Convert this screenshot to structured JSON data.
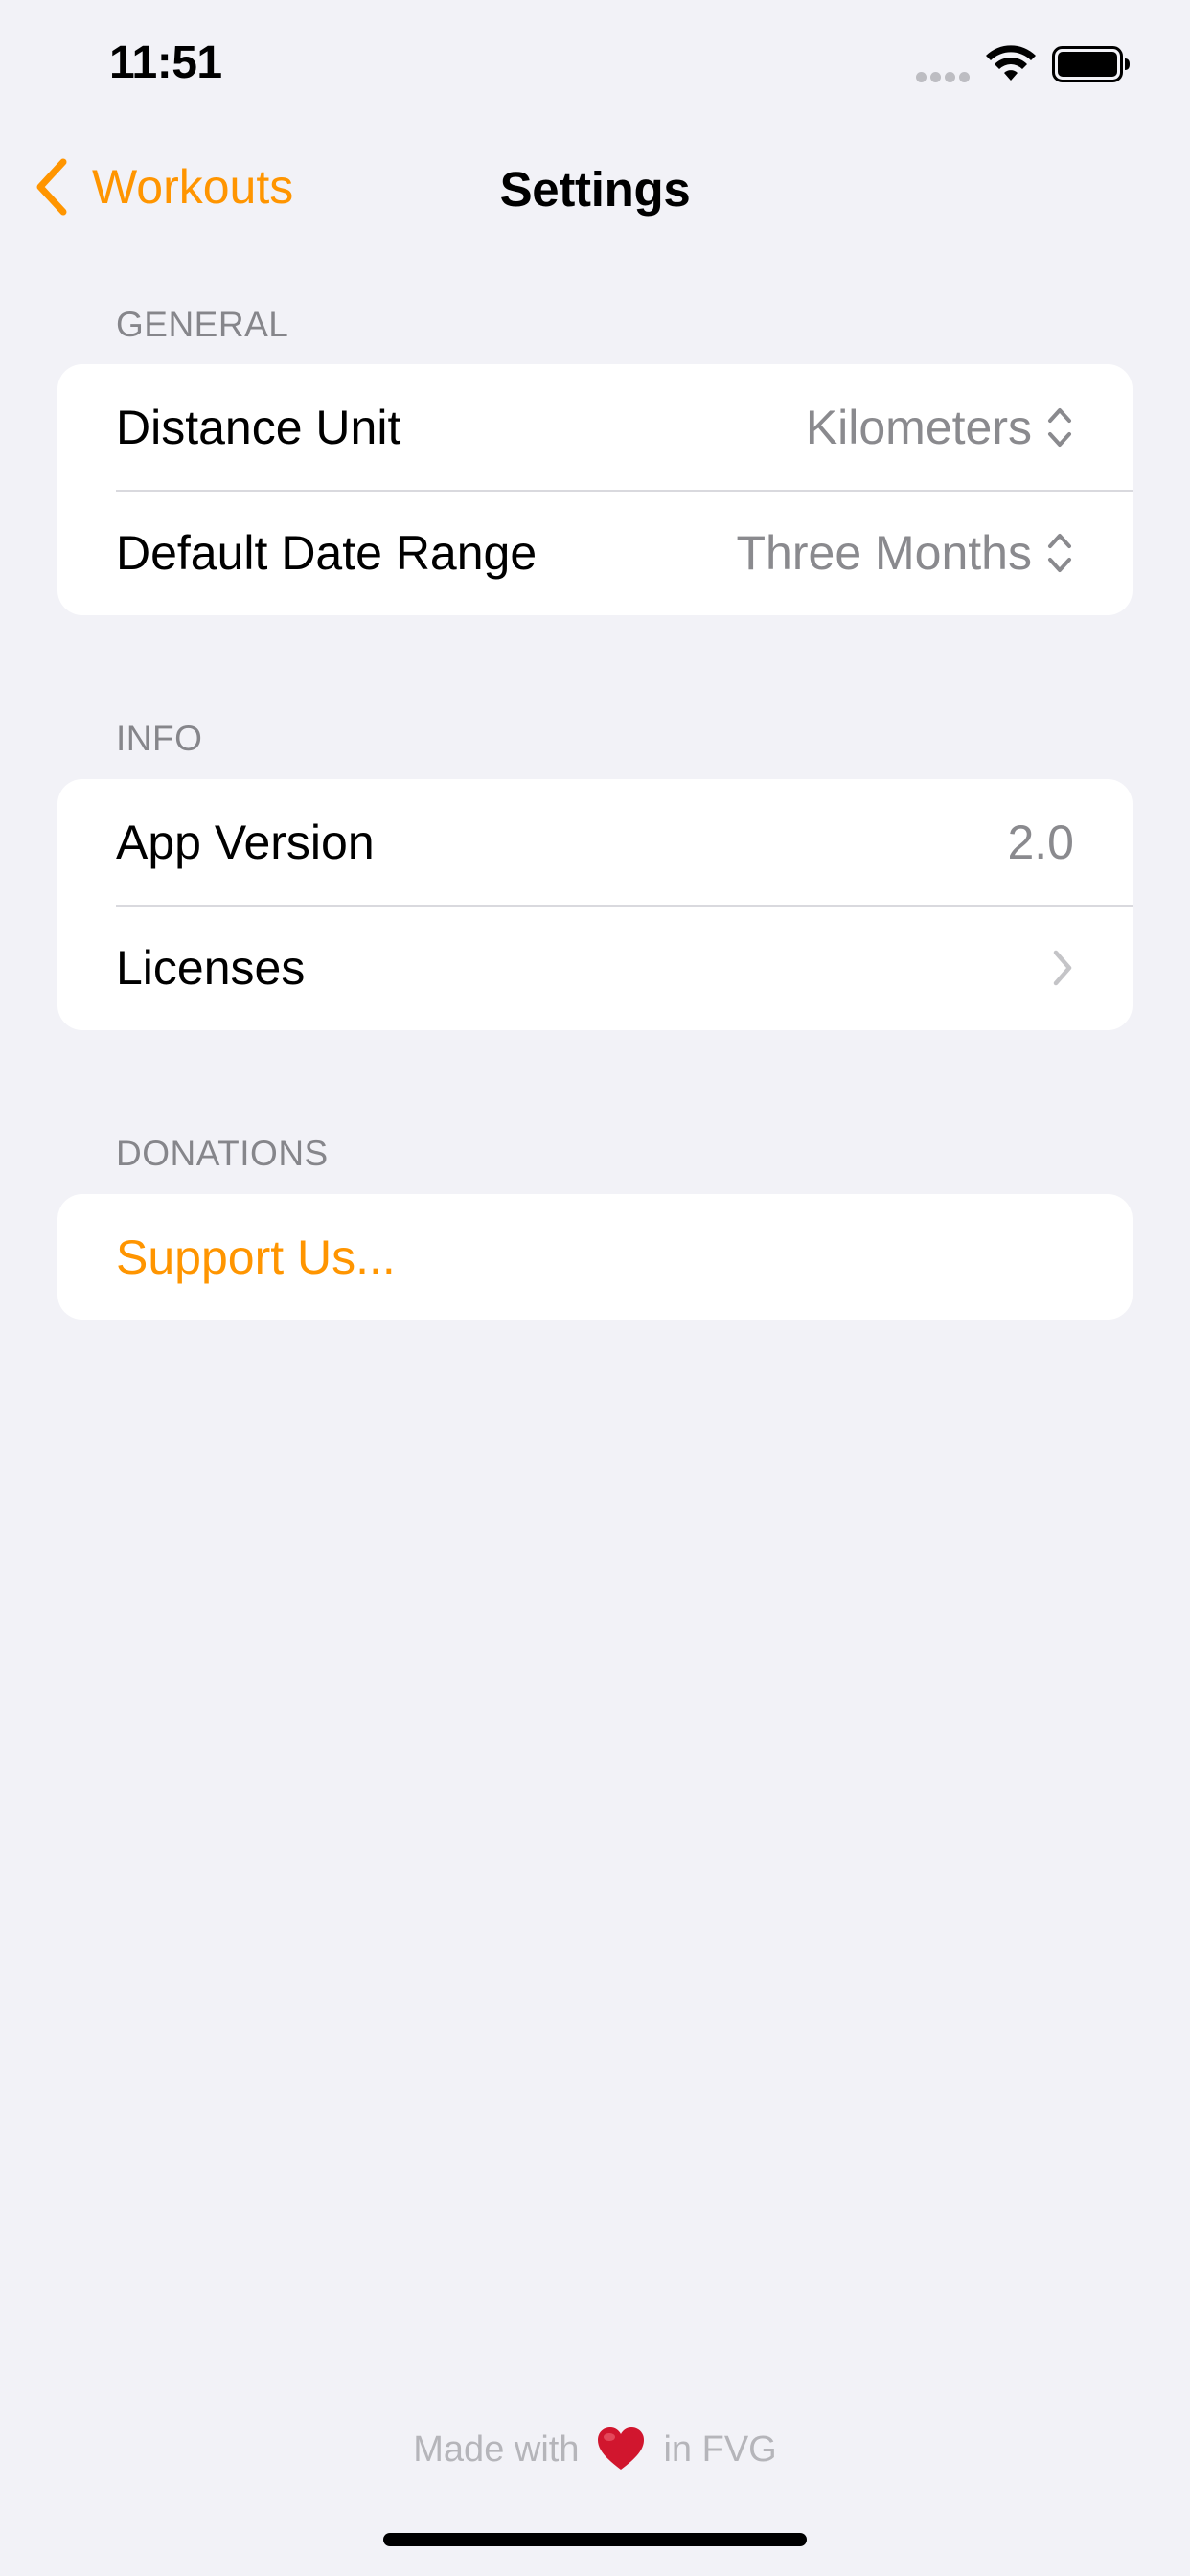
{
  "status_bar": {
    "time": "11:51"
  },
  "nav": {
    "back_label": "Workouts",
    "title": "Settings"
  },
  "sections": {
    "general": {
      "header": "GENERAL",
      "distance_unit_label": "Distance Unit",
      "distance_unit_value": "Kilometers",
      "date_range_label": "Default Date Range",
      "date_range_value": "Three Months"
    },
    "info": {
      "header": "INFO",
      "app_version_label": "App Version",
      "app_version_value": "2.0",
      "licenses_label": "Licenses"
    },
    "donations": {
      "header": "DONATIONS",
      "support_label": "Support Us..."
    }
  },
  "footer": {
    "prefix": "Made with",
    "suffix": "in FVG"
  },
  "colors": {
    "accent": "#FF9500",
    "background": "#F2F2F7",
    "card": "#FFFFFF",
    "secondary_text": "#8A8A8E",
    "heart": "#D1162E"
  },
  "icons": {
    "back": "chevron-left-icon",
    "picker": "chevron-up-down-icon",
    "disclosure": "chevron-right-icon",
    "heart": "heart-icon",
    "wifi": "wifi-icon",
    "battery": "battery-icon",
    "signal": "cellular-signal-icon"
  }
}
